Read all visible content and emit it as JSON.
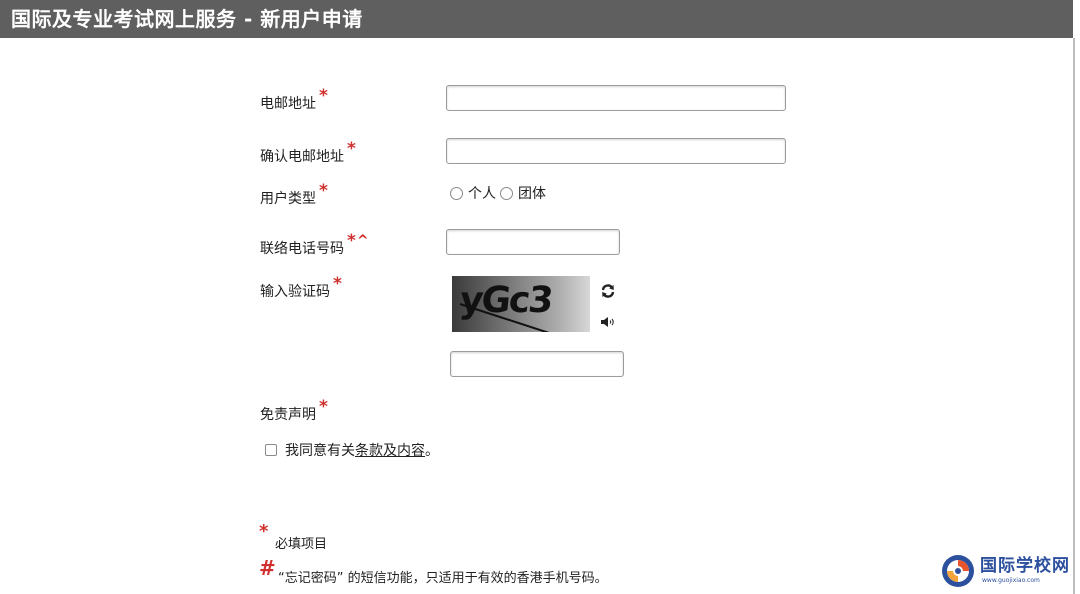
{
  "header": {
    "title": "国际及专业考试网上服务 - 新用户申请"
  },
  "form": {
    "email": {
      "label": "电邮地址",
      "required_mark": "*",
      "value": "",
      "placeholder": ""
    },
    "confirm_email": {
      "label": "确认电邮地址",
      "required_mark": "*",
      "value": "",
      "placeholder": ""
    },
    "user_type": {
      "label": "用户类型",
      "required_mark": "*",
      "options": [
        "个人",
        "团体"
      ]
    },
    "phone": {
      "label": "联络电话号码",
      "required_mark": "*",
      "extra_mark": "^",
      "value": ""
    },
    "captcha": {
      "label": "输入验证码",
      "required_mark": "*",
      "image_text": "yGc3",
      "refresh_icon": "refresh-icon",
      "audio_icon": "speaker-icon",
      "value": ""
    },
    "disclaimer": {
      "label": "免责声明",
      "required_mark": "*",
      "agree_prefix": "我同意有关",
      "agree_link": "条款及内容",
      "agree_suffix": "。"
    }
  },
  "legend": {
    "required_symbol": "*",
    "required_text": "必填项目",
    "hash_symbol": "#",
    "hash_text": "“忘记密码” 的短信功能，只适用于有效的香港手机号码。"
  },
  "watermark": {
    "name": "国际学校网",
    "url": "www.guojixiao.com"
  },
  "colors": {
    "header_bg": "#5f5f5f",
    "required_red": "#d0302f",
    "watermark_blue": "#2c4f9e"
  }
}
